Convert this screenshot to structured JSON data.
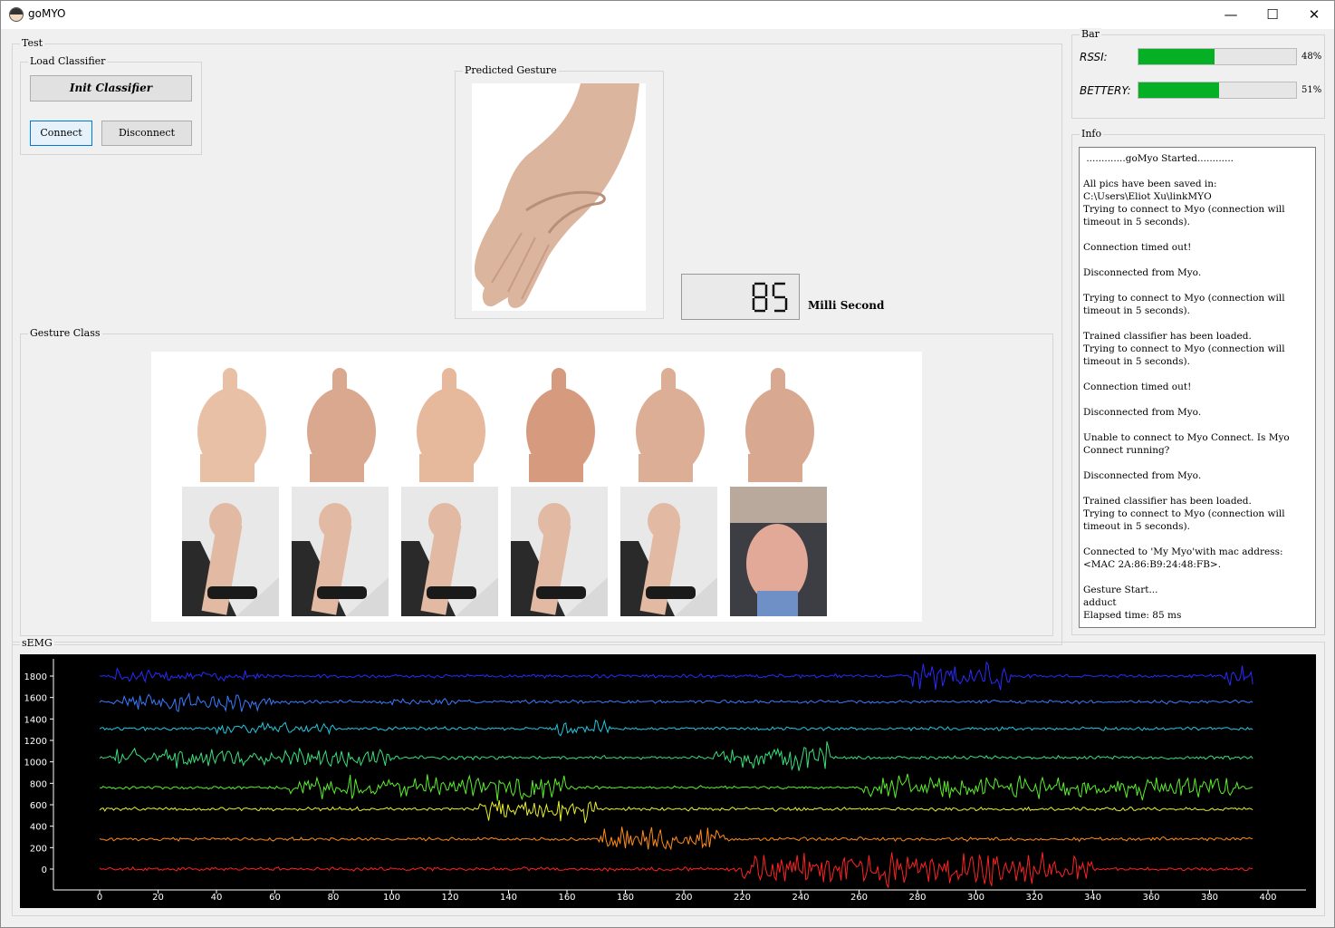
{
  "window": {
    "title": "goMYO",
    "controls": {
      "minimize": "—",
      "maximize": "☐",
      "close": "✕"
    }
  },
  "test_group": {
    "label": "Test",
    "load_classifier": {
      "label": "Load Classifier",
      "init_button": "Init Classifier",
      "connect_button": "Connect",
      "disconnect_button": "Disconnect"
    },
    "predicted_gesture": {
      "label": "Predicted Gesture",
      "image": "open-palm-hand"
    },
    "timer": {
      "value": "85",
      "unit": "Milli Second"
    }
  },
  "gesture_class": {
    "label": "Gesture Class",
    "row1": [
      "thumbs-up",
      "shaka",
      "ok-sign",
      "victory",
      "open-palm",
      "palm-up"
    ],
    "row2": [
      "fist-arm",
      "wrist-flex-arm",
      "wrist-extend-arm",
      "pinch-arm",
      "curl-arm",
      "spread-hand"
    ]
  },
  "bar_group": {
    "label": "Bar",
    "rssi": {
      "label": "RSSI:",
      "percent": 48,
      "text": "48%"
    },
    "battery": {
      "label": "BETTERY:",
      "percent": 51,
      "text": "51%"
    },
    "fill_color": "#06b025"
  },
  "info_group": {
    "label": "Info",
    "log": " .............goMyo Started............\n\nAll pics have been saved in:\nC:\\Users\\Eliot Xu\\linkMYO\nTrying to connect to Myo (connection will timeout in 5 seconds).\n\nConnection timed out!\n\nDisconnected from Myo.\n\nTrying to connect to Myo (connection will timeout in 5 seconds).\n\nTrained classifier has been loaded.\nTrying to connect to Myo (connection will timeout in 5 seconds).\n\nConnection timed out!\n\nDisconnected from Myo.\n\nUnable to connect to Myo Connect. Is Myo Connect running?\n\nDisconnected from Myo.\n\nTrained classifier has been loaded.\nTrying to connect to Myo (connection will timeout in 5 seconds).\n\nConnected to 'My Myo'with mac address:\n<MAC 2A:86:B9:24:48:FB>.\n\nGesture Start...\nadduct\nElapsed time: 85 ms"
  },
  "semg": {
    "label": "sEMG",
    "chart_data": {
      "type": "line",
      "x_range": [
        0,
        400
      ],
      "y_ticks": [
        0,
        200,
        400,
        600,
        800,
        1000,
        1200,
        1400,
        1600,
        1800
      ],
      "x_ticks": [
        0,
        20,
        40,
        60,
        80,
        100,
        120,
        140,
        160,
        180,
        200,
        220,
        240,
        260,
        280,
        300,
        320,
        340,
        360,
        380,
        400
      ],
      "background": "#000000",
      "axis_color": "#ffffff",
      "series": [
        {
          "channel": 1,
          "baseline": 1800,
          "color": "#2a2aff",
          "bursts": [
            [
              5,
              55,
              55
            ],
            [
              278,
              312,
              110
            ],
            [
              385,
              395,
              80
            ]
          ]
        },
        {
          "channel": 2,
          "baseline": 1560,
          "color": "#3a7bff",
          "bursts": [
            [
              8,
              60,
              80
            ],
            [
              95,
              130,
              30
            ]
          ]
        },
        {
          "channel": 3,
          "baseline": 1310,
          "color": "#22c8e0",
          "bursts": [
            [
              40,
              80,
              50
            ],
            [
              155,
              175,
              70
            ]
          ]
        },
        {
          "channel": 4,
          "baseline": 1040,
          "color": "#39e07a",
          "bursts": [
            [
              5,
              100,
              90
            ],
            [
              210,
              250,
              120
            ]
          ]
        },
        {
          "channel": 5,
          "baseline": 760,
          "color": "#5aef2a",
          "bursts": [
            [
              65,
              160,
              110
            ],
            [
              260,
              390,
              100
            ]
          ]
        },
        {
          "channel": 6,
          "baseline": 560,
          "color": "#e8f02a",
          "bursts": [
            [
              130,
              170,
              120
            ]
          ]
        },
        {
          "channel": 7,
          "baseline": 280,
          "color": "#ff8c1a",
          "bursts": [
            [
              170,
              215,
              110
            ]
          ]
        },
        {
          "channel": 8,
          "baseline": 0,
          "color": "#ff2222",
          "bursts": [
            [
              220,
              340,
              140
            ]
          ]
        }
      ]
    }
  }
}
